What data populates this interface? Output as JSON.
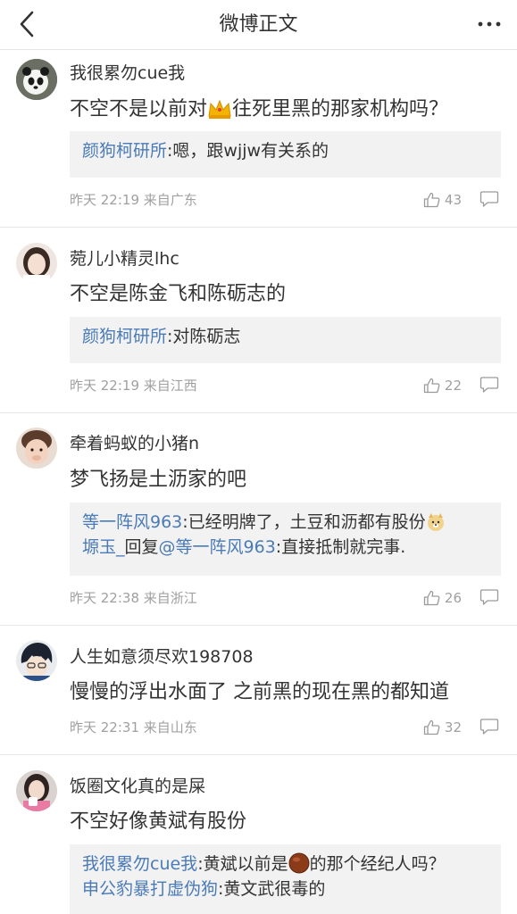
{
  "header": {
    "title": "微博正文"
  },
  "colors": {
    "link": "#4a7bb7",
    "meta": "#a0a0a0",
    "reply_bg": "#f2f2f2"
  },
  "comments": [
    {
      "username": "我很累勿cue我",
      "text_before": "不空不是以前对",
      "emoji": "crown-emoji",
      "text_after": "往死里黑的那家机构吗？",
      "replies": [
        {
          "name": "颜狗柯研所",
          "text": ":嗯，跟wjjw有关系的"
        }
      ],
      "time": "昨天 22:19",
      "location": "来自广东",
      "likes": "43"
    },
    {
      "username": "菀儿小精灵lhc",
      "text": "不空是陈金飞和陈砺志的",
      "replies": [
        {
          "name": "颜狗柯研所",
          "text": ":对陈砺志"
        }
      ],
      "time": "昨天 22:19",
      "location": "来自江西",
      "likes": "22"
    },
    {
      "username": "牵着蚂蚁的小猪n",
      "text": "梦飞扬是土沥家的吧",
      "replies": [
        {
          "name": "等一阵风963",
          "text": ":已经明牌了，土豆和沥都有股份",
          "emoji": "doge-emoji"
        },
        {
          "name": "塬玉_",
          "mid": "回复",
          "mention": "@等一阵风963",
          "text": ":直接抵制就完事."
        }
      ],
      "time": "昨天 22:38",
      "location": "来自浙江",
      "likes": "26"
    },
    {
      "username": "人生如意须尽欢198708",
      "text": "慢慢的浮出水面了 之前黑的现在黑的都知道",
      "time": "昨天 22:31",
      "location": "来自山东",
      "likes": "32"
    },
    {
      "username": "饭圈文化真的是屎",
      "text": "不空好像黄斌有股份",
      "replies": [
        {
          "name": "我很累勿cue我",
          "text_before": ":黄斌以前是",
          "emoji": "chestnut-emoji",
          "text": "的那个经纪人吗？"
        },
        {
          "name": "申公豹暴打虚伪狗",
          "text": ":黄文武很毒的"
        }
      ]
    }
  ]
}
